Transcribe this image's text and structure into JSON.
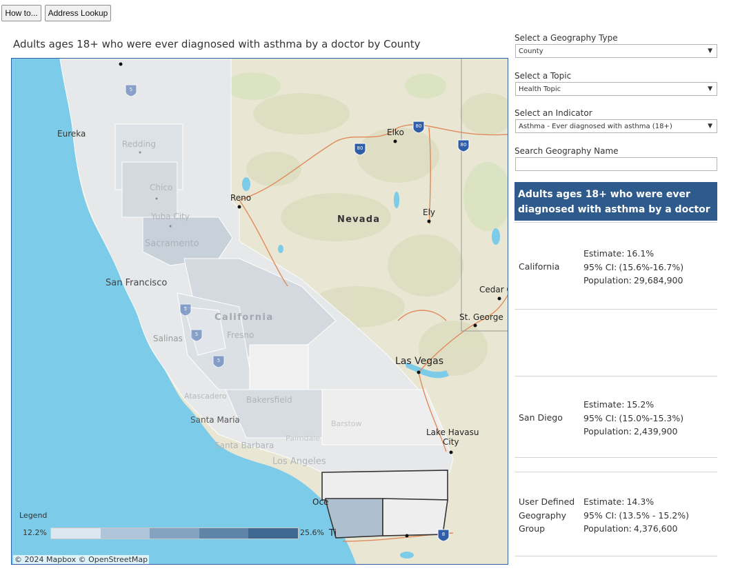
{
  "toolbar": {
    "howto_label": "How to...",
    "address_label": "Address Lookup"
  },
  "map": {
    "title": "Adults ages 18+ who were ever diagnosed with asthma by a doctor by County",
    "labels": {
      "eureka": "Eureka",
      "redding": "Redding",
      "chico": "Chico",
      "yuba_city": "Yuba City",
      "sacramento": "Sacramento",
      "san_francisco": "San Francisco",
      "salinas": "Salinas",
      "fresno": "Fresno",
      "california": "California",
      "atascadero": "Atascadero",
      "bakersfield": "Bakersfield",
      "santa_maria": "Santa Maria",
      "santa_barbara": "Santa Barbara",
      "los_angeles": "Los Angeles",
      "palmdale": "Palmdale",
      "barstow": "Barstow",
      "reno": "Reno",
      "nevada": "Nevada",
      "elko": "Elko",
      "ely": "Ely",
      "cedar_city": "Cedar C",
      "st_george": "St. George",
      "las_vegas": "Las Vegas",
      "lake_havasu": "Lake Havasu City",
      "oceanside": "Oce",
      "tijuana": "Ti"
    },
    "interstates": [
      "80",
      "80",
      "80",
      "5",
      "5",
      "5",
      "5",
      "8"
    ],
    "legend": {
      "title": "Legend",
      "min": "12.2%",
      "max": "25.6%",
      "colors": [
        "#dbe6ef",
        "#aec5d9",
        "#83a3c1",
        "#5e84a8",
        "#3f6891"
      ]
    },
    "attribution": "© 2024 Mapbox  © OpenStreetMap"
  },
  "controls": {
    "geo_type_label": "Select a Geography Type",
    "geo_type_value": "County",
    "topic_label": "Select a Topic",
    "topic_value": "Health Topic",
    "indicator_label": "Select an Indicator",
    "indicator_value": "Asthma - Ever diagnosed with asthma (18+)",
    "search_label": "Search Geography Name",
    "search_value": ""
  },
  "panel": {
    "header": "Adults ages 18+ who were ever diagnosed with asthma by a doctor",
    "rows": [
      {
        "name": "California",
        "estimate_label": "Estimate:",
        "estimate": "16.1%",
        "ci_label": "95% CI:",
        "ci": "(15.6%-16.7%)",
        "pop_label": "Population:",
        "population": "29,684,900"
      },
      {
        "name": "San Diego",
        "estimate_label": "Estimate:",
        "estimate": "15.2%",
        "ci_label": "95% CI:",
        "ci": "(15.0%-15.3%)",
        "pop_label": "Population:",
        "population": "2,439,900"
      },
      {
        "name_lines": [
          "User Defined",
          "Geography",
          "Group"
        ],
        "estimate_label": "Estimate:",
        "estimate": "14.3%",
        "ci_label": "95% CI:",
        "ci": "(13.5% - 15.2%)",
        "pop_label": "Population:",
        "population": "4,376,600"
      }
    ]
  },
  "colors": {
    "ocean": "#78cbe8",
    "land": "#e8e6d4",
    "header_bg": "#2e5a8c",
    "map_border": "#2f5f9e"
  }
}
